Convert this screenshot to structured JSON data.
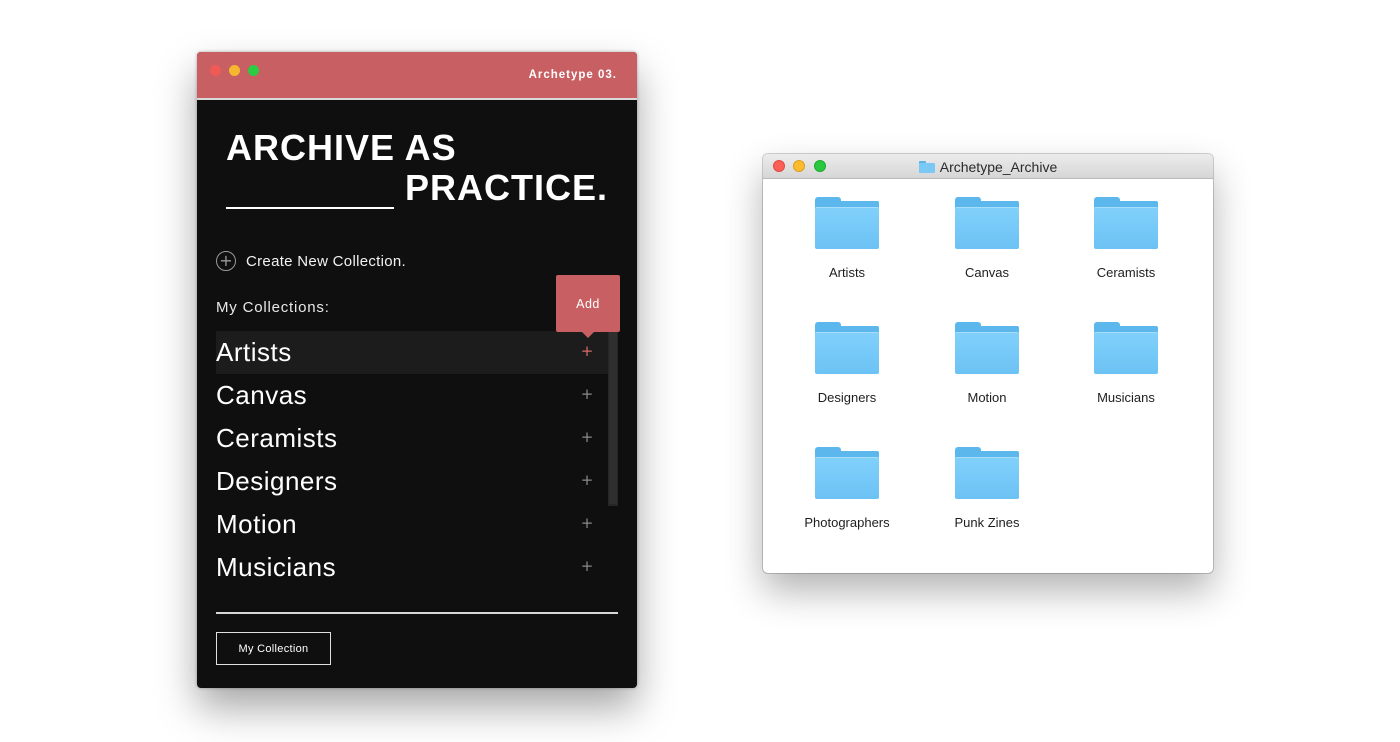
{
  "app": {
    "brand": "Archetype 03.",
    "headline_line1": "ARCHIVE AS",
    "headline_line2": "PRACTICE.",
    "create_icon": "plus-circle-icon",
    "create_label": "Create New Collection.",
    "my_collections_label": "My Collections:",
    "tooltip_label": "Add",
    "collections": [
      {
        "name": "Artists",
        "icon": "+"
      },
      {
        "name": "Canvas",
        "icon": "+"
      },
      {
        "name": "Ceramists",
        "icon": "+"
      },
      {
        "name": "Designers",
        "icon": "+"
      },
      {
        "name": "Motion",
        "icon": "+"
      },
      {
        "name": "Musicians",
        "icon": "+"
      }
    ],
    "active_collection": "Artists",
    "footer_button": "My Collection",
    "colors": {
      "accent": "#c85f62",
      "background": "#0f0f0f"
    }
  },
  "finder": {
    "title": "Archetype_Archive",
    "folders": [
      {
        "name": "Artists"
      },
      {
        "name": "Canvas"
      },
      {
        "name": "Ceramists"
      },
      {
        "name": "Designers"
      },
      {
        "name": "Motion"
      },
      {
        "name": "Musicians"
      },
      {
        "name": "Photographers"
      },
      {
        "name": "Punk Zines"
      }
    ]
  }
}
